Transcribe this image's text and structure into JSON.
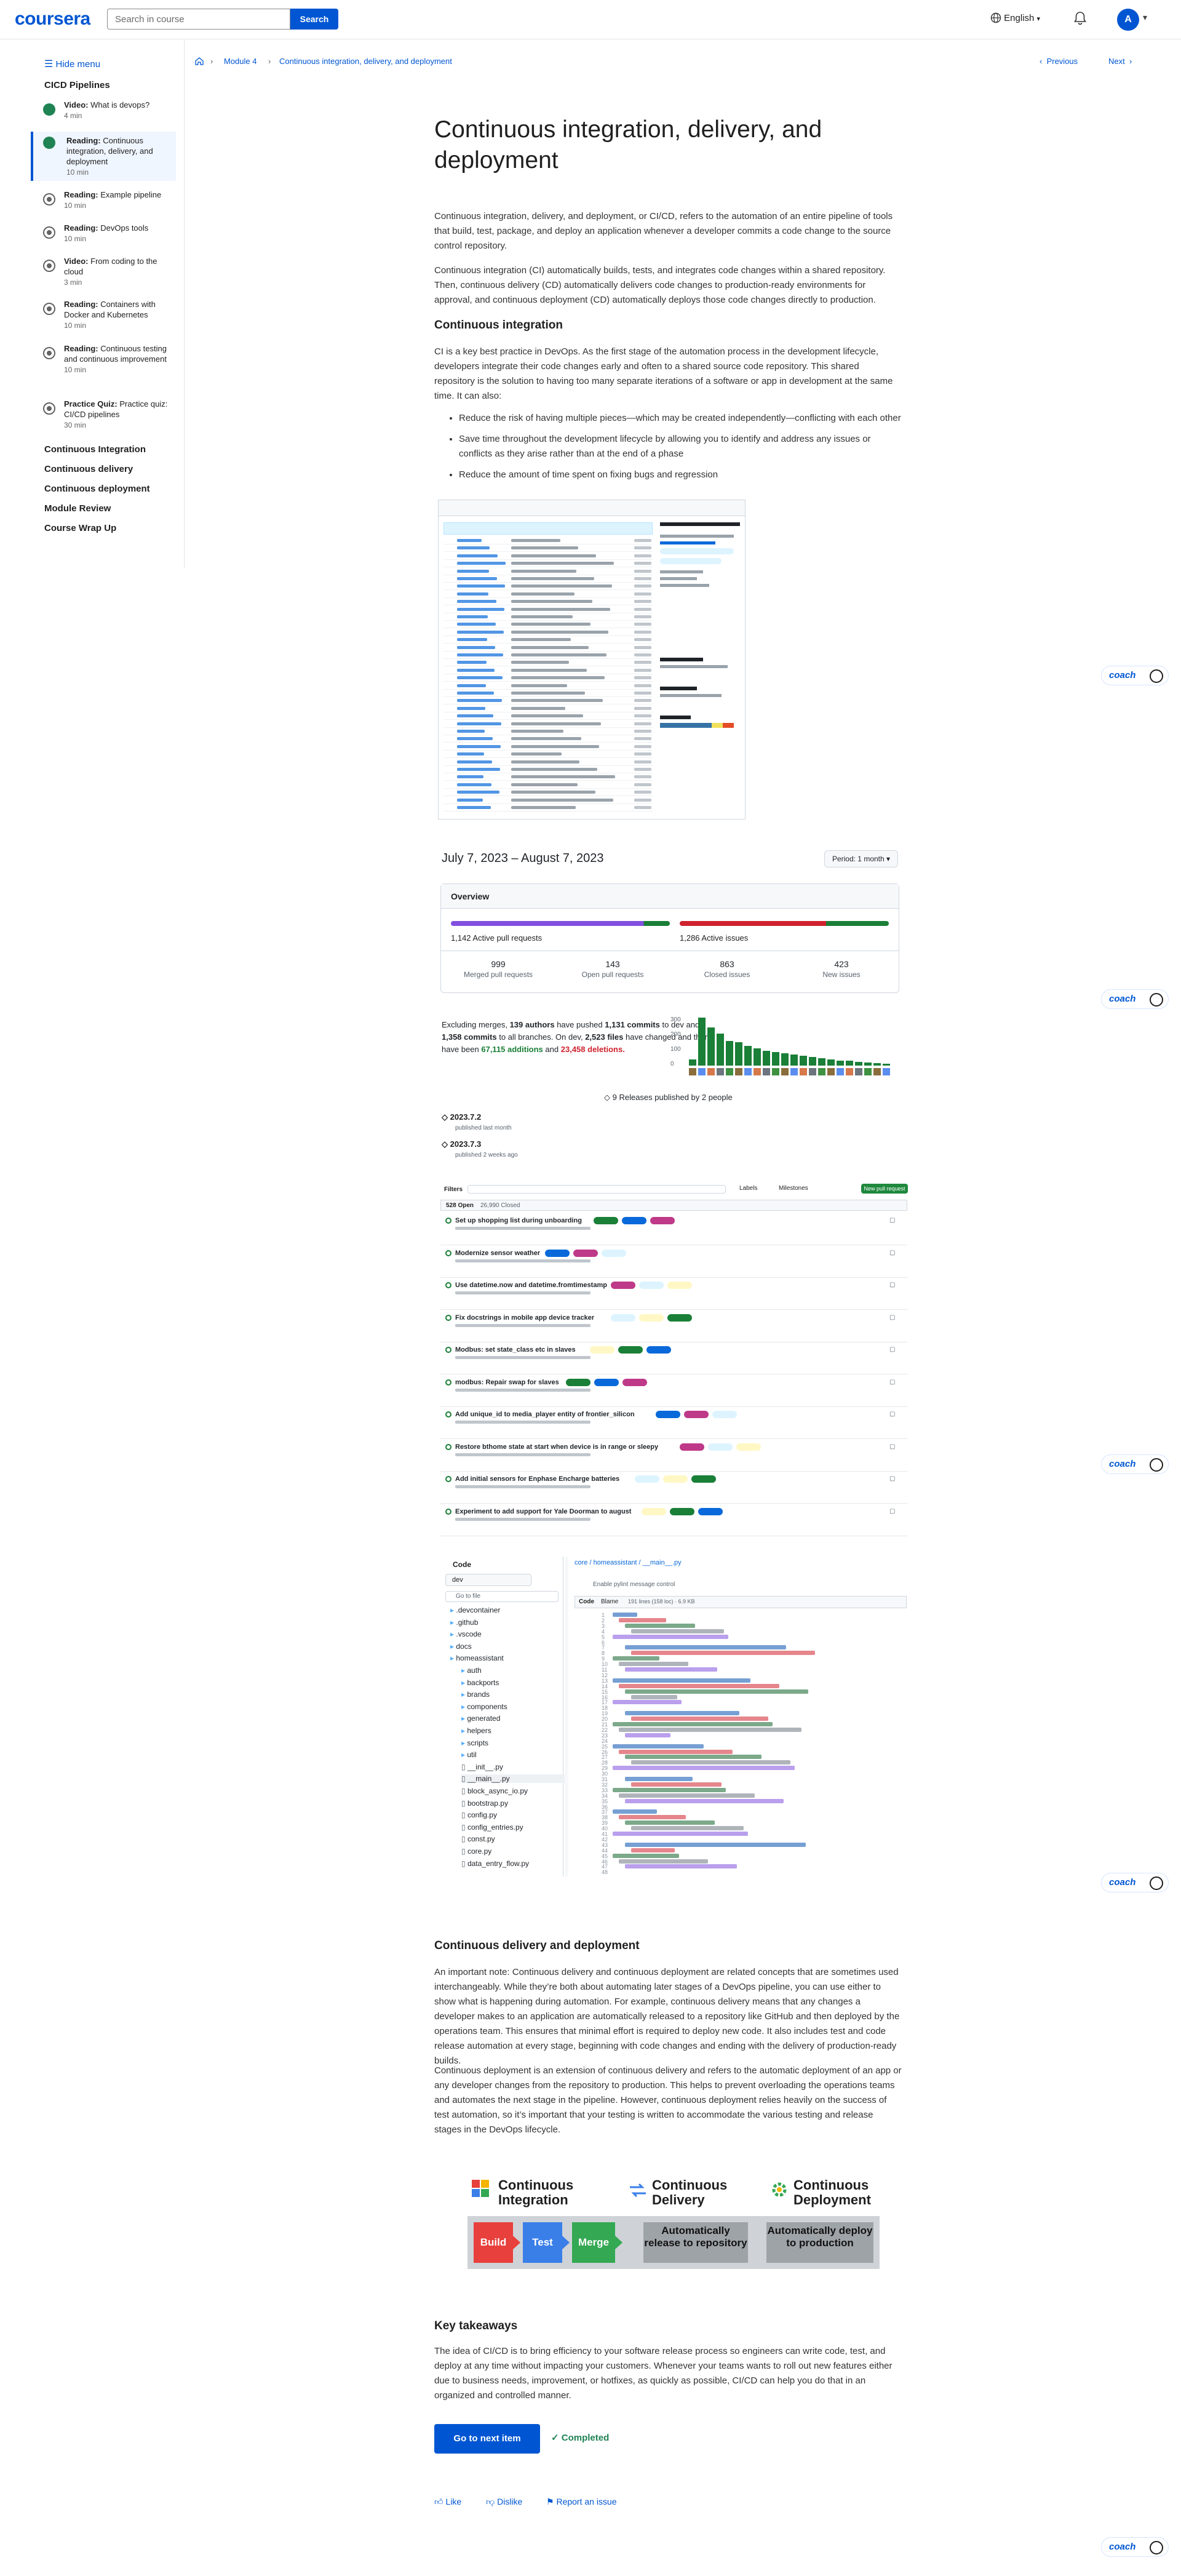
{
  "header": {
    "logo": "coursera",
    "search_placeholder": "Search in course",
    "search_button": "Search",
    "language": "English",
    "avatar_initial": "A"
  },
  "sidebar": {
    "hide_menu": "Hide menu",
    "module_title": "CICD Pipelines",
    "items": [
      {
        "type": "Video:",
        "title": "What is devops?",
        "duration": "4 min",
        "status": "done"
      },
      {
        "type": "Reading:",
        "title": "Continuous integration, delivery, and deployment",
        "duration": "10 min",
        "status": "done"
      },
      {
        "type": "Reading:",
        "title": "Example pipeline",
        "duration": "10 min",
        "status": "todo"
      },
      {
        "type": "Reading:",
        "title": "DevOps tools",
        "duration": "10 min",
        "status": "todo"
      },
      {
        "type": "Video:",
        "title": "From coding to the cloud",
        "duration": "3 min",
        "status": "todo"
      },
      {
        "type": "Reading:",
        "title": "Containers with Docker and Kubernetes",
        "duration": "10 min",
        "status": "todo"
      },
      {
        "type": "Reading:",
        "title": "Continuous testing and continuous improvement",
        "duration": "10 min",
        "status": "todo"
      },
      {
        "type": "Practice Quiz:",
        "title": "Practice quiz: CI/CD pipelines",
        "duration": "30 min",
        "status": "todo"
      }
    ],
    "sections": [
      "Continuous Integration",
      "Continuous delivery",
      "Continuous deployment",
      "Module Review",
      "Course Wrap Up"
    ]
  },
  "breadcrumb": {
    "module": "Module 4",
    "page": "Continuous integration, delivery, and deployment",
    "previous": "Previous",
    "next": "Next"
  },
  "article": {
    "title": "Continuous integration, delivery, and deployment",
    "intro_1": "Continuous integration, delivery, and deployment, or CI/CD, refers to the automation of an entire pipeline of tools that build, test, package, and deploy an application whenever a developer commits a code change to the source control repository.",
    "intro_2": "Continuous integration (CI) automatically builds, tests, and integrates code changes within a shared repository. Then, continuous delivery (CD) automatically delivers code changes to production-ready environments for approval, and continuous deployment (CD) automatically deploys those code changes directly to production.",
    "ci_heading": "Continuous integration",
    "ci_body": "CI is a key best practice in DevOps. As the first stage of the automation process in the development lifecycle, developers integrate their code changes early and often to a shared source code repository. This shared repository is the solution to having too many separate iterations of a software or app in development at the same time. It can also:",
    "bullets": [
      "Reduce the risk of having multiple pieces—which may be created independently—conflicting with each other",
      "Save time throughout the development lifecycle by allowing you to identify and address any issues or conflicts as they arise rather than at the end of a phase",
      "Reduce the amount of time spent on fixing bugs and regression"
    ],
    "cd_heading": "Continuous delivery and deployment",
    "cd_body_1": "An important note: Continuous delivery and continuous deployment are related concepts that are sometimes used interchangeably. While they’re both about automating later stages of a DevOps pipeline, you can use either to show what is happening during automation. For example, continuous delivery means that any changes a developer makes to an application are automatically released to a repository like GitHub and then deployed by the operations team. This ensures that minimal effort is required to deploy new code. It also includes test and code release automation at every stage, beginning with code changes and ending with the delivery of production-ready builds.",
    "cd_body_2": "Continuous deployment is an extension of continuous delivery and refers to the automatic deployment of an app or any developer changes from the repository to production. This helps to prevent overloading the operations teams and automates the next stage in the pipeline. However, continuous deployment relies heavily on the success of test automation, so it’s important that your testing is written to accommodate the various testing and release stages in the DevOps lifecycle.",
    "takeaways_heading": "Key takeaways",
    "takeaways_body": "The idea of CI/CD is to bring efficiency to your software release process so engineers can write code, test, and deploy at any time without impacting your customers. Whenever your teams wants to roll out new features either due to business needs, improvement, or hotfixes, as quickly as possible, CI/CD can help you do that in an organized and controlled manner."
  },
  "coach": {
    "label": "coach"
  },
  "pulse": {
    "date_range": "July 7, 2023 – August 7, 2023",
    "period": "Period: 1 month",
    "overview": "Overview",
    "active_prs": "1,142 Active pull requests",
    "active_issues": "1,286 Active issues",
    "merged": "999",
    "merged_label": "Merged pull requests",
    "open": "143",
    "open_label": "Open pull requests",
    "closed": "863",
    "closed_label": "Closed issues",
    "new": "423",
    "new_label": "New issues",
    "summary_a": "Excluding merges,",
    "authors": "139 authors",
    "summary_b": "have pushed",
    "commits_main": "1,131 commits",
    "summary_c": "to dev and",
    "commits_all": "1,358 commits",
    "summary_d": "to all branches. On dev,",
    "files": "2,523 files",
    "summary_e": "have changed and there have been",
    "additions": "67,115 additions",
    "summary_f": "and",
    "deletions": "23,458 deletions.",
    "releases": "9 Releases published by 2 people",
    "release_1": "2023.7.2",
    "release_1_sub": "published last month",
    "release_2": "2023.7.3",
    "release_2_sub": "published 2 weeks ago",
    "chart_ticks": [
      "300",
      "200",
      "100",
      "0"
    ]
  },
  "issues": {
    "filters": "Filters",
    "labels_btn": "Labels",
    "milestones_btn": "Milestones",
    "new_pr": "New pull request",
    "open_count": "528 Open",
    "closed_count": "26,990 Closed",
    "rows": [
      "Set up shopping list during unboarding",
      "Modernize sensor weather",
      "Use datetime.now and datetime.fromtimestamp",
      "Fix docstrings in mobile app device tracker",
      "Modbus: set state_class etc in slaves",
      "modbus: Repair swap for slaves",
      "Add unique_id to media_player entity of frontier_silicon",
      "Restore bthome state at start when device is in range or sleepy",
      "Add initial sensors for Enphase Encharge batteries",
      "Experiment to add support for Yale Doorman to august"
    ]
  },
  "code": {
    "panel_title": "Code",
    "branch": "dev",
    "goto": "Go to file",
    "path": "core / homeassistant / __main__.py",
    "commit": "Enable pylint message control",
    "tab_code": "Code",
    "tab_blame": "Blame",
    "lines_meta": "191 lines (158 loc) · 6.9 KB",
    "tree": [
      ".devcontainer",
      ".github",
      ".vscode",
      "docs",
      "homeassistant",
      "auth",
      "backports",
      "brands",
      "components",
      "generated",
      "helpers",
      "scripts",
      "util",
      "__init__.py",
      "__main__.py",
      "block_async_io.py",
      "bootstrap.py",
      "config.py",
      "config_entries.py",
      "const.py",
      "core.py",
      "data_entry_flow.py"
    ]
  },
  "diagram": {
    "ci_title": "Continuous Integration",
    "cdel_title": "Continuous Delivery",
    "cdep_title": "Continuous Deployment",
    "build": "Build",
    "test": "Test",
    "merge": "Merge",
    "release": "Automatically release to repository",
    "deploy": "Automatically deploy to production",
    "colors": {
      "build": "#e8403c",
      "test": "#3a7ee8",
      "merge": "#34a853",
      "grey": "#9ea3a8"
    }
  },
  "footer": {
    "next_button": "Go to next item",
    "completed": "Completed",
    "like": "Like",
    "dislike": "Dislike",
    "report": "Report an issue"
  }
}
